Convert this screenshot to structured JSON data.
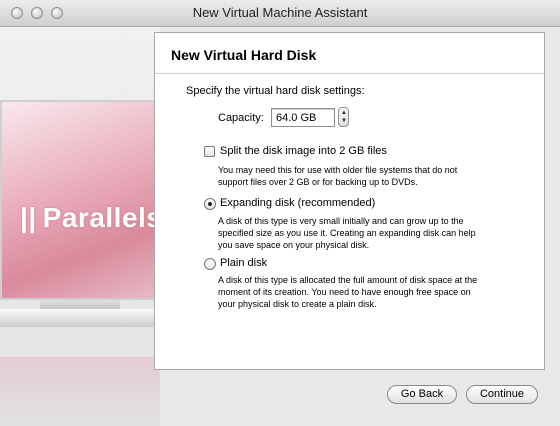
{
  "window": {
    "title": "New Virtual Machine Assistant"
  },
  "sidebar": {
    "logo_text": "Parallels",
    "logo_mark": "||"
  },
  "panel": {
    "heading": "New Virtual Hard Disk",
    "instructions": "Specify the virtual hard disk settings:",
    "capacity": {
      "label": "Capacity:",
      "value": "64.0 GB"
    },
    "split_option": {
      "label": "Split the disk image into 2 GB files",
      "checked": false,
      "description_1": "You may need this for use with older file systems that do not",
      "description_2": "support files over 2 GB or for backing up to DVDs."
    },
    "disk_types": [
      {
        "label": "Expanding disk (recommended)",
        "selected": true,
        "description_1": "A disk of this type is very small initially and can grow up to the",
        "description_2": "specified size as you use it. Creating an expanding disk can help",
        "description_3": "you save space on your physical disk."
      },
      {
        "label": "Plain disk",
        "selected": false,
        "description_1": "A disk of this type is allocated the full amount of disk space at the",
        "description_2": "moment of its creation. You need to have enough free space on",
        "description_3": "your physical disk to create a plain disk."
      }
    ]
  },
  "buttons": {
    "back": "Go Back",
    "continue": "Continue"
  }
}
